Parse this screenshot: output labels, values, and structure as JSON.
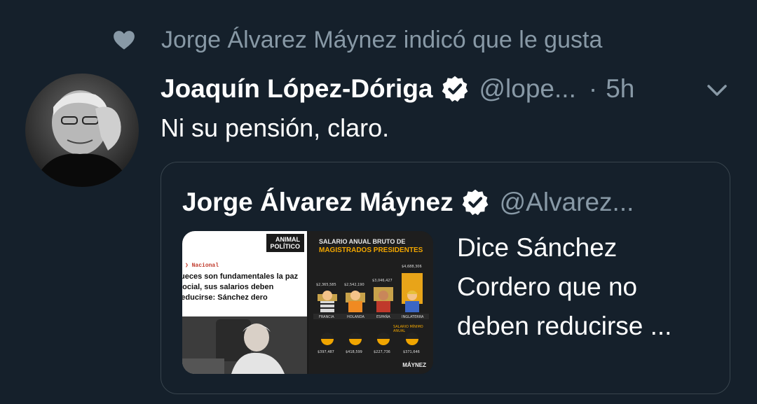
{
  "social_context": {
    "text": "Jorge Álvarez Máynez indicó que le gusta",
    "icon": "heart-icon"
  },
  "tweet": {
    "author_name": "Joaquín López-Dóriga",
    "handle": "@lope...",
    "separator": "·",
    "time": "5h",
    "text": "Ni su pensión, claro."
  },
  "quote": {
    "author_name": "Jorge Álvarez Máynez",
    "handle": "@Alvarez...",
    "text_lines": [
      "Dice Sánchez",
      "Cordero que no",
      "deben reducirse ..."
    ],
    "media": {
      "article": {
        "logo_line1": "ANIMAL",
        "logo_line2": "POLÍTICO",
        "section": "Nacional",
        "headline": "jueces son fundamentales la paz social, sus salarios deben reducirse: Sánchez dero"
      },
      "infographic": {
        "title": "SALARIO ANUAL BRUTO DE",
        "subtitle": "MAGISTRADOS PRESIDENTES",
        "values": [
          "$2,365,585",
          "$2,542,190",
          "$3,046,427",
          "$4,688,306"
        ],
        "countries": [
          "FRANCIA",
          "HOLANDA",
          "ESPAÑA",
          "INGLATERRA"
        ],
        "min_wage_label": "SALARIO MÍNIMO ANUAL",
        "min_wage_values": [
          "$397,487",
          "$418,599",
          "$227,736",
          "$371,646"
        ],
        "brand": "MÁYNEZ"
      }
    }
  },
  "colors": {
    "background": "#15202b",
    "primary_text": "#ffffff",
    "secondary_text": "#8899a6",
    "border": "#38444d"
  }
}
